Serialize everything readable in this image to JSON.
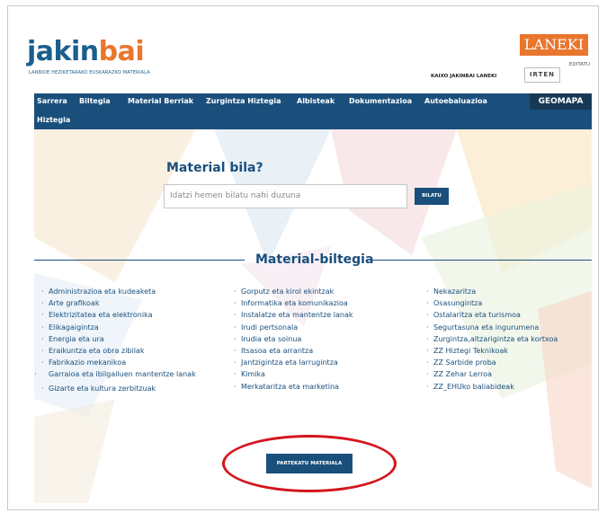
{
  "header": {
    "logo_part1": "jakin",
    "logo_part2": "bai",
    "logo_subtitle": "LANBIDE HEZIKETARAKO EUSKARAZKO MATERIALA",
    "partner_logo": "LANEKI",
    "user_name": "KAIXO JAKINBAI LANEKI",
    "logout_label": "IRTEN",
    "edit_label": "EDITATU"
  },
  "nav": {
    "items": [
      "Sarrera",
      "Biltegia",
      "Material Berriak",
      "Zurgintza Hiztegia",
      "Albisteak",
      "Dokumentazioa",
      "Autoebaluazioa"
    ],
    "second_row": "Hiztegia",
    "geomapa": "GEOMAPA"
  },
  "search": {
    "title": "Material bila?",
    "placeholder": "Idatzi hemen bilatu nahi duzuna",
    "button": "BILATU"
  },
  "section_title": "Material-biltegia",
  "categories": {
    "col1": [
      "Administrazioa eta kudeaketa",
      "Arte grafikoak",
      "Elektrizitatea eta elektronika",
      "Elikagaigintza",
      "Energia eta ura",
      "Eraikuntza eta obra zibilak",
      "Fabrikazio mekanikoa",
      "Garraioa eta ibilgailuen mantentze lanak",
      "Gizarte eta kultura zerbitzuak"
    ],
    "col2": [
      "Gorputz eta kirol ekintzak",
      "Informatika eta komunikazioa",
      "Instalatze eta mantentze lanak",
      "Irudi pertsonala",
      "Irudia eta soinua",
      "Itsasoa eta arrantza",
      "Jantzigintza eta larrugintza",
      "Kimika",
      "Merkataritza eta marketina"
    ],
    "col3": [
      "Nekazaritza",
      "Osasungintza",
      "Ostalaritza eta turismoa",
      "Segurtasuna eta ingurumena",
      "Zurgintza,altzarigintza eta kortxoa",
      "ZZ Hiztegi Teknikoak",
      "ZZ Sarbide proba",
      "ZZ Zehar Lerroa",
      "ZZ_EHUko baliabideak"
    ]
  },
  "share_button": "PARTEKATU MATERIALA",
  "colors": {
    "primary": "#1a4f7c",
    "accent": "#e8762d",
    "highlight": "#d4151d"
  }
}
